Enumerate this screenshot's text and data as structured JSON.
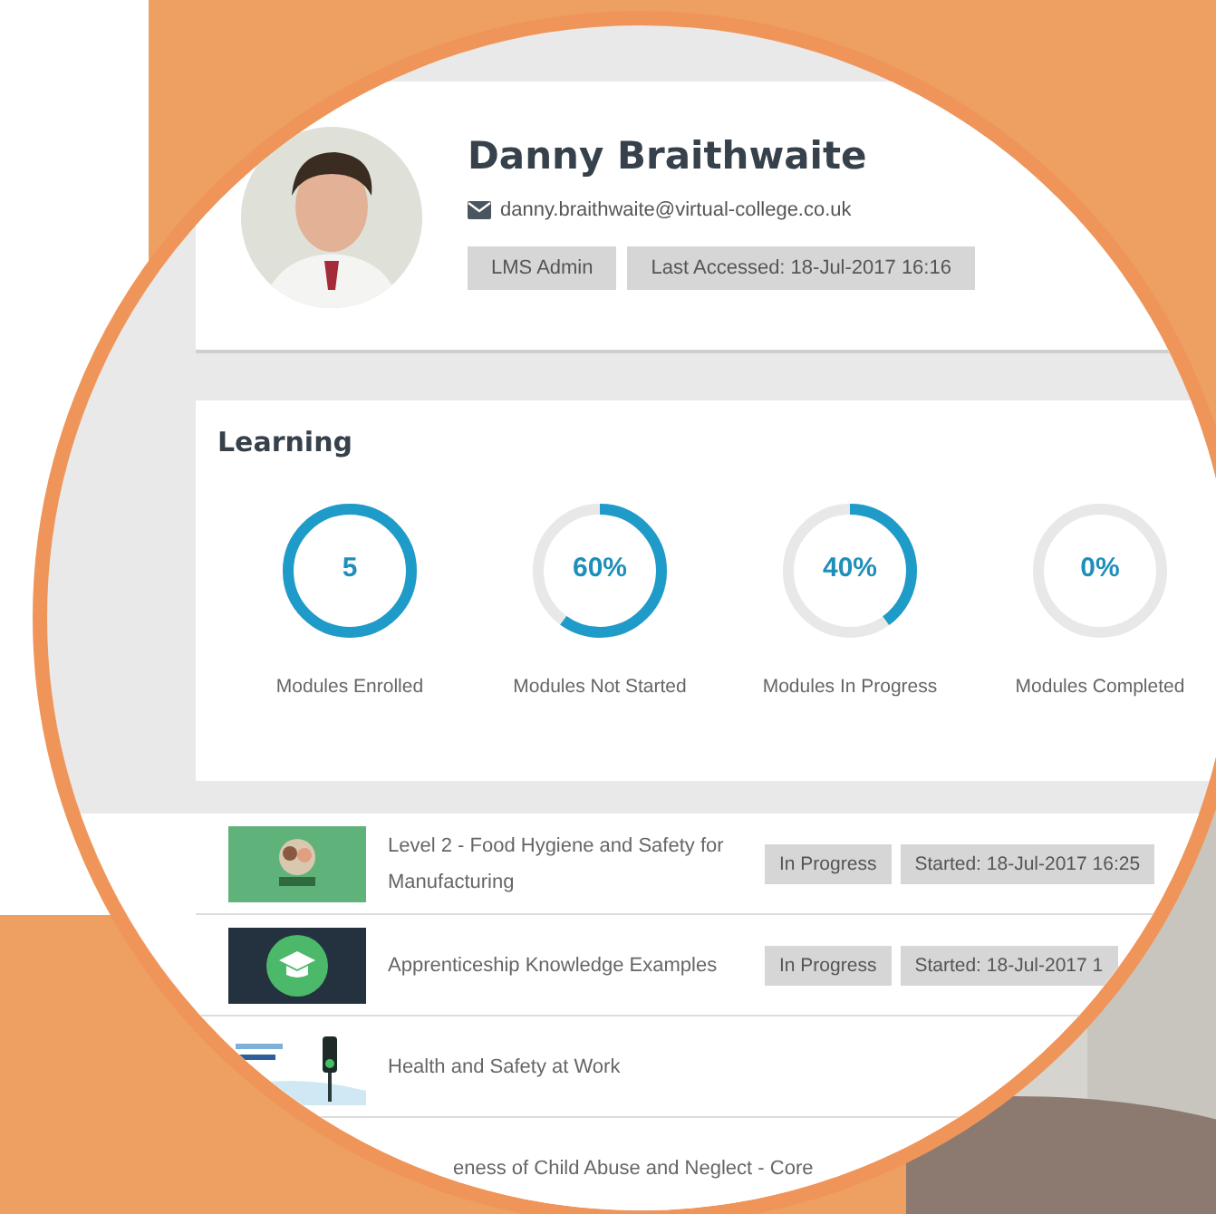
{
  "profile": {
    "name": "Danny Braithwaite",
    "email": "danny.braithwaite@virtual-college.co.uk",
    "badges": [
      "LMS Admin",
      "Last Accessed: 18-Jul-2017 16:16"
    ]
  },
  "learning": {
    "title": "Learning",
    "stats": [
      {
        "value": "5",
        "label": "Modules Enrolled",
        "level": 1
      },
      {
        "value": "60%",
        "label": "Modules Not Started",
        "level": 0.6
      },
      {
        "value": "40%",
        "label": "Modules In Progress",
        "level": 0.4
      },
      {
        "value": "0%",
        "label": "Modules Completed",
        "level": 0
      }
    ]
  },
  "modules": [
    {
      "kind": "picture",
      "title": "Level 2 - Food Hygiene and Safety for Manufacturing",
      "status": "In Progress",
      "started": "Started: 18-Jul-2017 16:25"
    },
    {
      "kind": "icon",
      "title": "Apprenticeship Knowledge Examples",
      "status": "In Progress",
      "started": "Started: 18-Jul-2017 1"
    },
    {
      "kind": "sign",
      "title": "Health and Safety at Work"
    },
    {
      "title": "eness of Child Abuse and Neglect - Core"
    }
  ]
}
